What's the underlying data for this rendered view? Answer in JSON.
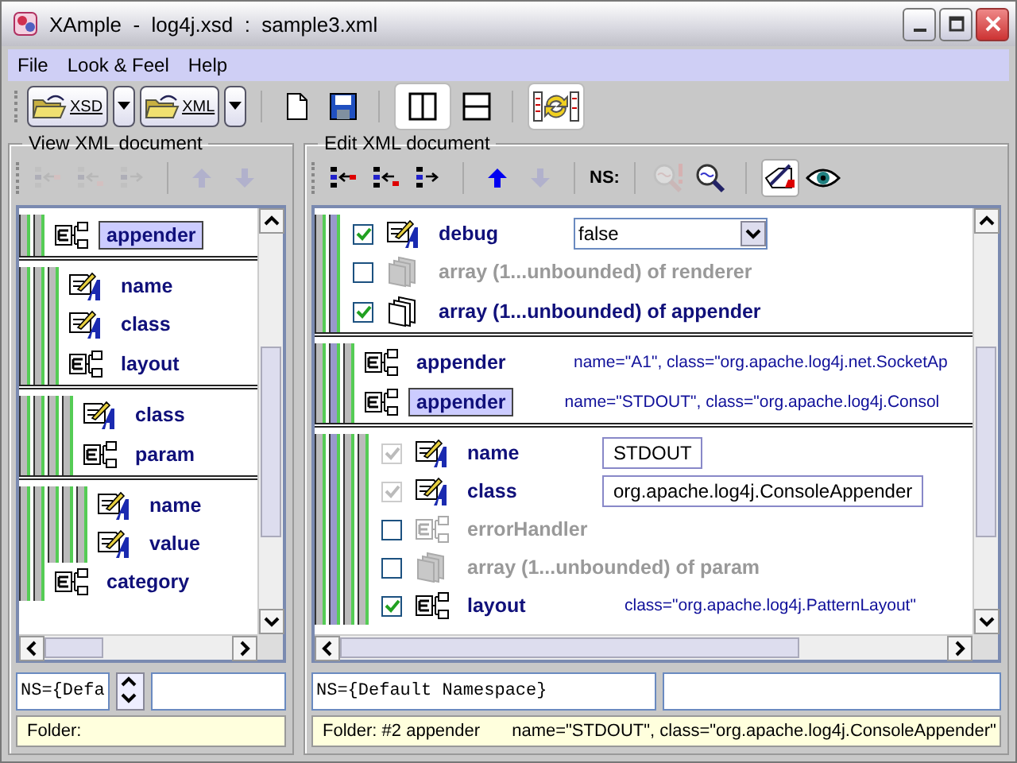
{
  "window": {
    "title": "XAmple  -  log4j.xsd  :  sample3.xml"
  },
  "menu": [
    "File",
    "Look & Feel",
    "Help"
  ],
  "toolbar": [
    {
      "kind": "open",
      "label": "XSD",
      "selected": false
    },
    {
      "kind": "dropdown",
      "selected": false
    },
    {
      "kind": "open",
      "label": "XML",
      "selected": false
    },
    {
      "kind": "dropdown",
      "selected": false
    },
    {
      "kind": "new",
      "selected": false
    },
    {
      "kind": "save",
      "selected": false
    },
    {
      "kind": "split-columns",
      "selected": true
    },
    {
      "kind": "split-rows",
      "selected": false
    },
    {
      "kind": "sync",
      "selected": true
    }
  ],
  "panels": [
    {
      "title": "View XML document",
      "tools": [
        {
          "kind": "insert-before",
          "disabled": true,
          "selected": false
        },
        {
          "kind": "insert-after",
          "disabled": true,
          "selected": false
        },
        {
          "kind": "insert-child",
          "disabled": true,
          "selected": false
        },
        {
          "kind": "up",
          "disabled": true,
          "selected": false
        },
        {
          "kind": "down",
          "disabled": true,
          "selected": false
        }
      ],
      "tree": [
        {
          "kind": "element",
          "label": "appender",
          "selected": true,
          "disabled": false,
          "children": [
            {
              "kind": "attribute",
              "label": "name",
              "selected": false,
              "disabled": false
            },
            {
              "kind": "attribute",
              "label": "class",
              "selected": false,
              "disabled": false
            },
            {
              "kind": "element",
              "label": "layout",
              "selected": false,
              "disabled": false,
              "children": [
                {
                  "kind": "attribute",
                  "label": "class",
                  "selected": false,
                  "disabled": false
                },
                {
                  "kind": "element",
                  "label": "param",
                  "selected": false,
                  "disabled": false,
                  "children": [
                    {
                      "kind": "attribute",
                      "label": "name",
                      "selected": false,
                      "disabled": false
                    },
                    {
                      "kind": "attribute",
                      "label": "value",
                      "selected": false,
                      "disabled": false
                    }
                  ]
                }
              ]
            }
          ]
        },
        {
          "kind": "element",
          "label": "category",
          "selected": false,
          "disabled": false
        }
      ],
      "ns": "NS={Defa",
      "spinner": true,
      "status": "Folder:"
    },
    {
      "title": "Edit XML document",
      "tools": [
        {
          "kind": "insert-before",
          "disabled": false,
          "selected": false
        },
        {
          "kind": "insert-after",
          "disabled": false,
          "selected": false
        },
        {
          "kind": "insert-child",
          "disabled": false,
          "selected": false
        },
        {
          "kind": "up",
          "disabled": false,
          "selected": false
        },
        {
          "kind": "down",
          "disabled": true,
          "selected": false
        },
        {
          "kind": "label",
          "label": "NS:"
        },
        {
          "kind": "find-error",
          "disabled": true,
          "selected": false
        },
        {
          "kind": "find",
          "disabled": false,
          "selected": false
        },
        {
          "kind": "edit",
          "disabled": false,
          "selected": true
        },
        {
          "kind": "view",
          "disabled": false,
          "selected": false
        }
      ],
      "tree": [
        {
          "kind": "attribute",
          "label": "debug",
          "checked": true,
          "selected": false,
          "disabled": false,
          "combo_value": "false"
        },
        {
          "kind": "array",
          "label": "array (1...unbounded) of renderer",
          "checked": false,
          "selected": false,
          "disabled": true
        },
        {
          "kind": "array",
          "label": "array (1...unbounded) of appender",
          "checked": true,
          "selected": false,
          "disabled": false,
          "children": [
            {
              "kind": "element",
              "label": "appender",
              "selected": false,
              "disabled": false,
              "attrs": "name=\"A1\", class=\"org.apache.log4j.net.SocketAp"
            },
            {
              "kind": "element",
              "label": "appender",
              "selected": true,
              "disabled": false,
              "attrs": "name=\"STDOUT\", class=\"org.apache.log4j.Consol",
              "children": [
                {
                  "kind": "attribute",
                  "label": "name",
                  "checked": true,
                  "selected": false,
                  "disabled": false,
                  "locked": true,
                  "field_value": "STDOUT"
                },
                {
                  "kind": "attribute",
                  "label": "class",
                  "checked": true,
                  "selected": false,
                  "disabled": false,
                  "locked": true,
                  "field_value": "org.apache.log4j.ConsoleAppender"
                },
                {
                  "kind": "element",
                  "label": "errorHandler",
                  "checked": false,
                  "selected": false,
                  "disabled": true
                },
                {
                  "kind": "array",
                  "label": "array (1...unbounded) of param",
                  "checked": false,
                  "selected": false,
                  "disabled": true
                },
                {
                  "kind": "element",
                  "label": "layout",
                  "checked": true,
                  "selected": false,
                  "disabled": false,
                  "attrs": "class=\"org.apache.log4j.PatternLayout\""
                }
              ]
            }
          ]
        }
      ],
      "ns": "NS={Default Namespace}",
      "status": "Folder: #2 appender",
      "status_detail": "name=\"STDOUT\", class=\"org.apache.log4j.ConsoleAppender\""
    }
  ]
}
